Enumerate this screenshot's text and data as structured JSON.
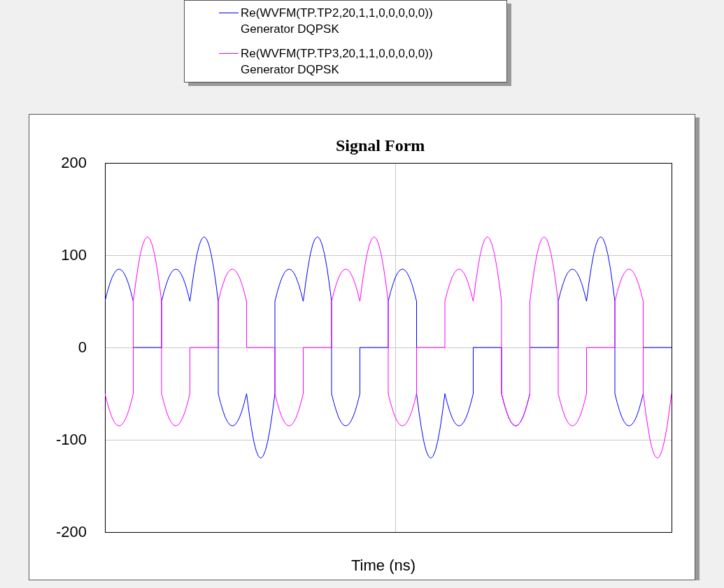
{
  "legend": {
    "entries": [
      {
        "label": "Re(WVFM(TP.TP2,20,1,1,0,0,0,0,0))",
        "sublabel": "Generator DQPSK",
        "color": "#0000ff"
      },
      {
        "label": "Re(WVFM(TP.TP3,20,1,1,0,0,0,0,0))",
        "sublabel": "Generator DQPSK",
        "color": "#ff00ff"
      }
    ]
  },
  "chart": {
    "title": "Signal Form",
    "xlabel": "Time (ns)",
    "y_tick_labels": [
      "200",
      "100",
      "0",
      "-100",
      "-200"
    ]
  }
}
